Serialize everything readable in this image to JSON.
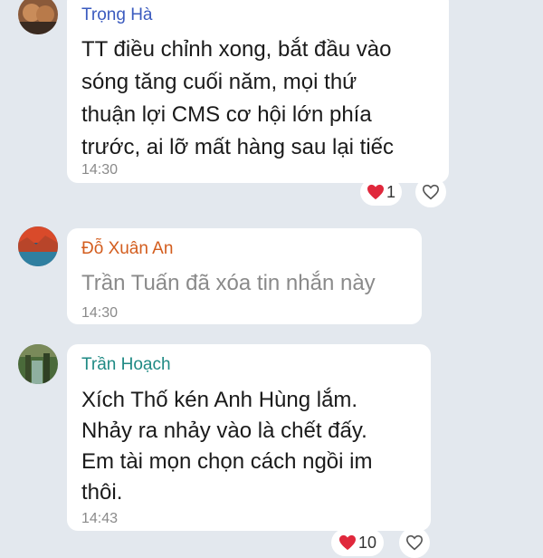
{
  "colors": {
    "background": "#e3e8ee",
    "bubble": "#ffffff",
    "sender_blue": "#3b5bbf",
    "sender_orange": "#d35d1e",
    "sender_teal": "#1f8a84",
    "muted": "#8a8a8a",
    "heart": "#e0283c"
  },
  "messages": [
    {
      "sender": "Trọng Hà",
      "lines": [
        "TT điều chỉnh xong, bắt đầu vào",
        "sóng tăng cuối năm, mọi thứ",
        "thuận lợi CMS cơ hội lớn phía",
        "trước, ai lỡ mất hàng sau lại tiếc"
      ],
      "time": "14:30",
      "reaction_icon": "heart-icon",
      "reaction_count": "1",
      "react_button_icon": "heart-outline-icon"
    },
    {
      "sender": "Đỗ Xuân An",
      "lines": [
        "Trần Tuấn đã xóa tin nhắn này"
      ],
      "time": "14:30"
    },
    {
      "sender": "Trần Hoạch",
      "lines": [
        "Xích Thố kén Anh Hùng lắm.",
        "Nhảy ra nhảy vào là chết đấy.",
        "Em tài mọn chọn cách ngồi im",
        "thôi."
      ],
      "time": "14:43",
      "reaction_icon": "heart-icon",
      "reaction_count": "10",
      "react_button_icon": "heart-outline-icon"
    }
  ]
}
